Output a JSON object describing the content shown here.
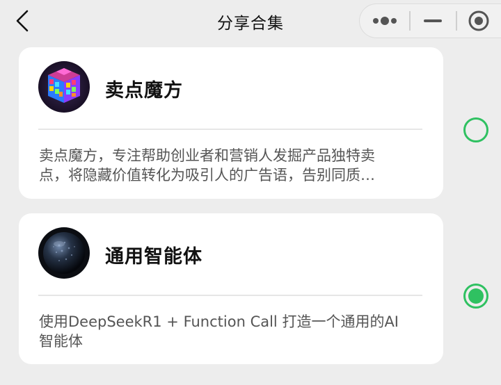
{
  "header": {
    "title": "分享合集"
  },
  "capsule": {
    "more_icon": "more-dots-icon",
    "minimize_icon": "minimize-icon",
    "close_icon": "target-close-icon"
  },
  "items": [
    {
      "name": "卖点魔方",
      "avatar_icon": "rubiks-cube-icon",
      "desc_line1": "卖点魔方，专注帮助创业者和营销人发掘产品独特卖",
      "desc_line2": "点，将隐藏价值转化为吸引人的广告语，告别同质…",
      "selected": false
    },
    {
      "name": "通用智能体",
      "avatar_icon": "dark-sphere-icon",
      "desc_line1": "使用DeepSeekR1 + Function Call 打造一个通用的AI",
      "desc_line2": "智能体",
      "selected": true
    }
  ],
  "colors": {
    "accent": "#2fc161",
    "background": "#ededed",
    "card": "#ffffff"
  }
}
